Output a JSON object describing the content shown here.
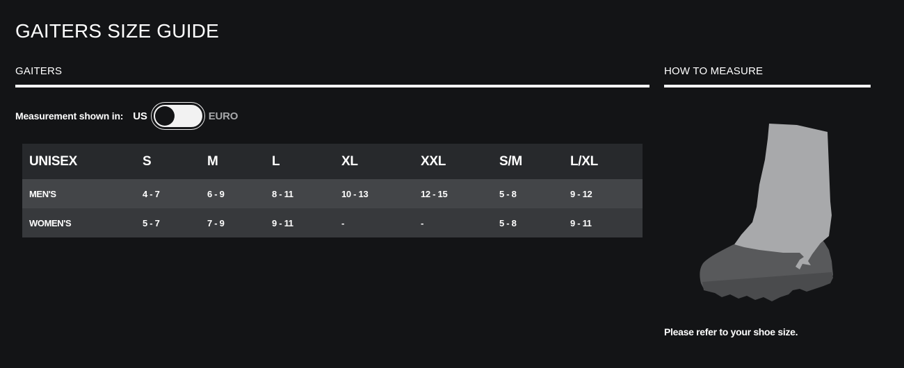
{
  "page": {
    "title": "GAITERS SIZE GUIDE"
  },
  "sections": {
    "gaiters_heading": "GAITERS",
    "how_to_measure_heading": "HOW TO MEASURE"
  },
  "measurement": {
    "label": "Measurement shown in:",
    "unit_left": "US",
    "unit_right": "EURO",
    "selected": "US"
  },
  "size_table": {
    "headers": [
      "UNISEX",
      "S",
      "M",
      "L",
      "XL",
      "XXL",
      "S/M",
      "L/XL"
    ],
    "rows": [
      {
        "label": "MEN'S",
        "values": [
          "4 - 7",
          "6 - 9",
          "8 - 11",
          "10 - 13",
          "12 - 15",
          "5 - 8",
          "9 - 12"
        ]
      },
      {
        "label": "WOMEN'S",
        "values": [
          "5 - 7",
          "7 - 9",
          "9 - 11",
          "-",
          "-",
          "5 - 8",
          "9 - 11"
        ]
      }
    ]
  },
  "how_to_measure": {
    "illustration": "gaiter-on-boot",
    "instruction": "Please refer to your shoe size."
  },
  "colors": {
    "background": "#131416",
    "header_row": "#27292c",
    "row_mens": "#434548",
    "row_womens": "#37393c",
    "gaiter": "#a8a9ab",
    "boot": "#58595b"
  }
}
